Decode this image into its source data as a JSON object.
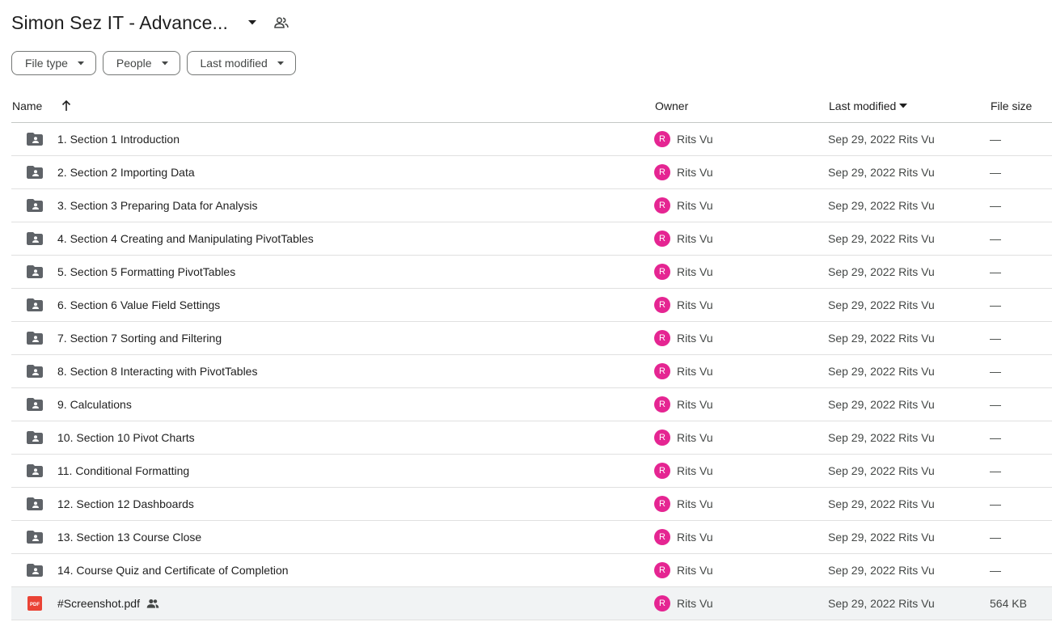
{
  "header": {
    "title": "Simon Sez IT - Advance..."
  },
  "filters": [
    {
      "label": "File type"
    },
    {
      "label": "People"
    },
    {
      "label": "Last modified"
    }
  ],
  "columns": {
    "name": "Name",
    "owner": "Owner",
    "modified": "Last modified",
    "size": "File size"
  },
  "rows": [
    {
      "name": "1. Section 1 Introduction",
      "type": "folder",
      "owner": "Rits Vu",
      "owner_initial": "R",
      "modified": "Sep 29, 2022 Rits Vu",
      "size": "—"
    },
    {
      "name": "2. Section 2 Importing Data",
      "type": "folder",
      "owner": "Rits Vu",
      "owner_initial": "R",
      "modified": "Sep 29, 2022 Rits Vu",
      "size": "—"
    },
    {
      "name": "3. Section 3 Preparing Data for Analysis",
      "type": "folder",
      "owner": "Rits Vu",
      "owner_initial": "R",
      "modified": "Sep 29, 2022 Rits Vu",
      "size": "—"
    },
    {
      "name": "4. Section 4 Creating and Manipulating PivotTables",
      "type": "folder",
      "owner": "Rits Vu",
      "owner_initial": "R",
      "modified": "Sep 29, 2022 Rits Vu",
      "size": "—"
    },
    {
      "name": "5. Section 5 Formatting PivotTables",
      "type": "folder",
      "owner": "Rits Vu",
      "owner_initial": "R",
      "modified": "Sep 29, 2022 Rits Vu",
      "size": "—"
    },
    {
      "name": "6. Section 6 Value Field Settings",
      "type": "folder",
      "owner": "Rits Vu",
      "owner_initial": "R",
      "modified": "Sep 29, 2022 Rits Vu",
      "size": "—"
    },
    {
      "name": "7. Section 7 Sorting and Filtering",
      "type": "folder",
      "owner": "Rits Vu",
      "owner_initial": "R",
      "modified": "Sep 29, 2022 Rits Vu",
      "size": "—"
    },
    {
      "name": "8. Section 8 Interacting with PivotTables",
      "type": "folder",
      "owner": "Rits Vu",
      "owner_initial": "R",
      "modified": "Sep 29, 2022 Rits Vu",
      "size": "—"
    },
    {
      "name": "9. Calculations",
      "type": "folder",
      "owner": "Rits Vu",
      "owner_initial": "R",
      "modified": "Sep 29, 2022 Rits Vu",
      "size": "—"
    },
    {
      "name": "10. Section 10 Pivot Charts",
      "type": "folder",
      "owner": "Rits Vu",
      "owner_initial": "R",
      "modified": "Sep 29, 2022 Rits Vu",
      "size": "—"
    },
    {
      "name": "11. Conditional Formatting",
      "type": "folder",
      "owner": "Rits Vu",
      "owner_initial": "R",
      "modified": "Sep 29, 2022 Rits Vu",
      "size": "—"
    },
    {
      "name": "12. Section 12 Dashboards",
      "type": "folder",
      "owner": "Rits Vu",
      "owner_initial": "R",
      "modified": "Sep 29, 2022 Rits Vu",
      "size": "—"
    },
    {
      "name": "13. Section 13 Course Close",
      "type": "folder",
      "owner": "Rits Vu",
      "owner_initial": "R",
      "modified": "Sep 29, 2022 Rits Vu",
      "size": "—"
    },
    {
      "name": "14. Course Quiz and Certificate of Completion",
      "type": "folder",
      "owner": "Rits Vu",
      "owner_initial": "R",
      "modified": "Sep 29, 2022 Rits Vu",
      "size": "—"
    },
    {
      "name": "#Screenshot.pdf",
      "type": "pdf",
      "shared": true,
      "selected": true,
      "owner": "Rits Vu",
      "owner_initial": "R",
      "modified": "Sep 29, 2022 Rits Vu",
      "size": "564 KB",
      "icon_text": "PDF"
    }
  ],
  "colors": {
    "avatar": "#e52592",
    "folder_icon": "#5f6368",
    "pdf_icon": "#ea4335",
    "selected_row": "#f1f3f4"
  }
}
